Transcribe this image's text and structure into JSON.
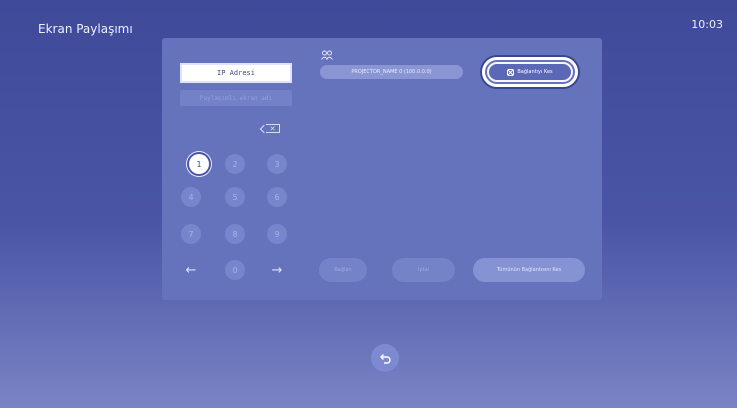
{
  "header": {
    "title": "Ekran Paylaşımı",
    "time": "10:03"
  },
  "form": {
    "ip_label": "IP Adresi",
    "password_placeholder": "Paylaşımlı ekran adı"
  },
  "keypad": {
    "keys": [
      "1",
      "2",
      "3",
      "4",
      "5",
      "6",
      "7",
      "8",
      "9",
      "←",
      "0",
      "→"
    ],
    "selected": "1"
  },
  "connection": {
    "projector_name": "PROJECTOR_NAME 0  (100.0.0.0)",
    "disconnect_label": "Bağlantıyı Kes"
  },
  "actions": {
    "connect_label": "Bağlan",
    "cancel_label": "İptal",
    "disconnect_all_label": "Tümünün Bağlantısını Kes"
  },
  "icons": {
    "backspace": "backspace-icon",
    "people": "people-icon",
    "disconnect": "x-icon",
    "back": "back-arrow-icon"
  },
  "colors": {
    "background": "#4a55a6",
    "panel": "#6573bd",
    "highlight": "#ffffff"
  }
}
